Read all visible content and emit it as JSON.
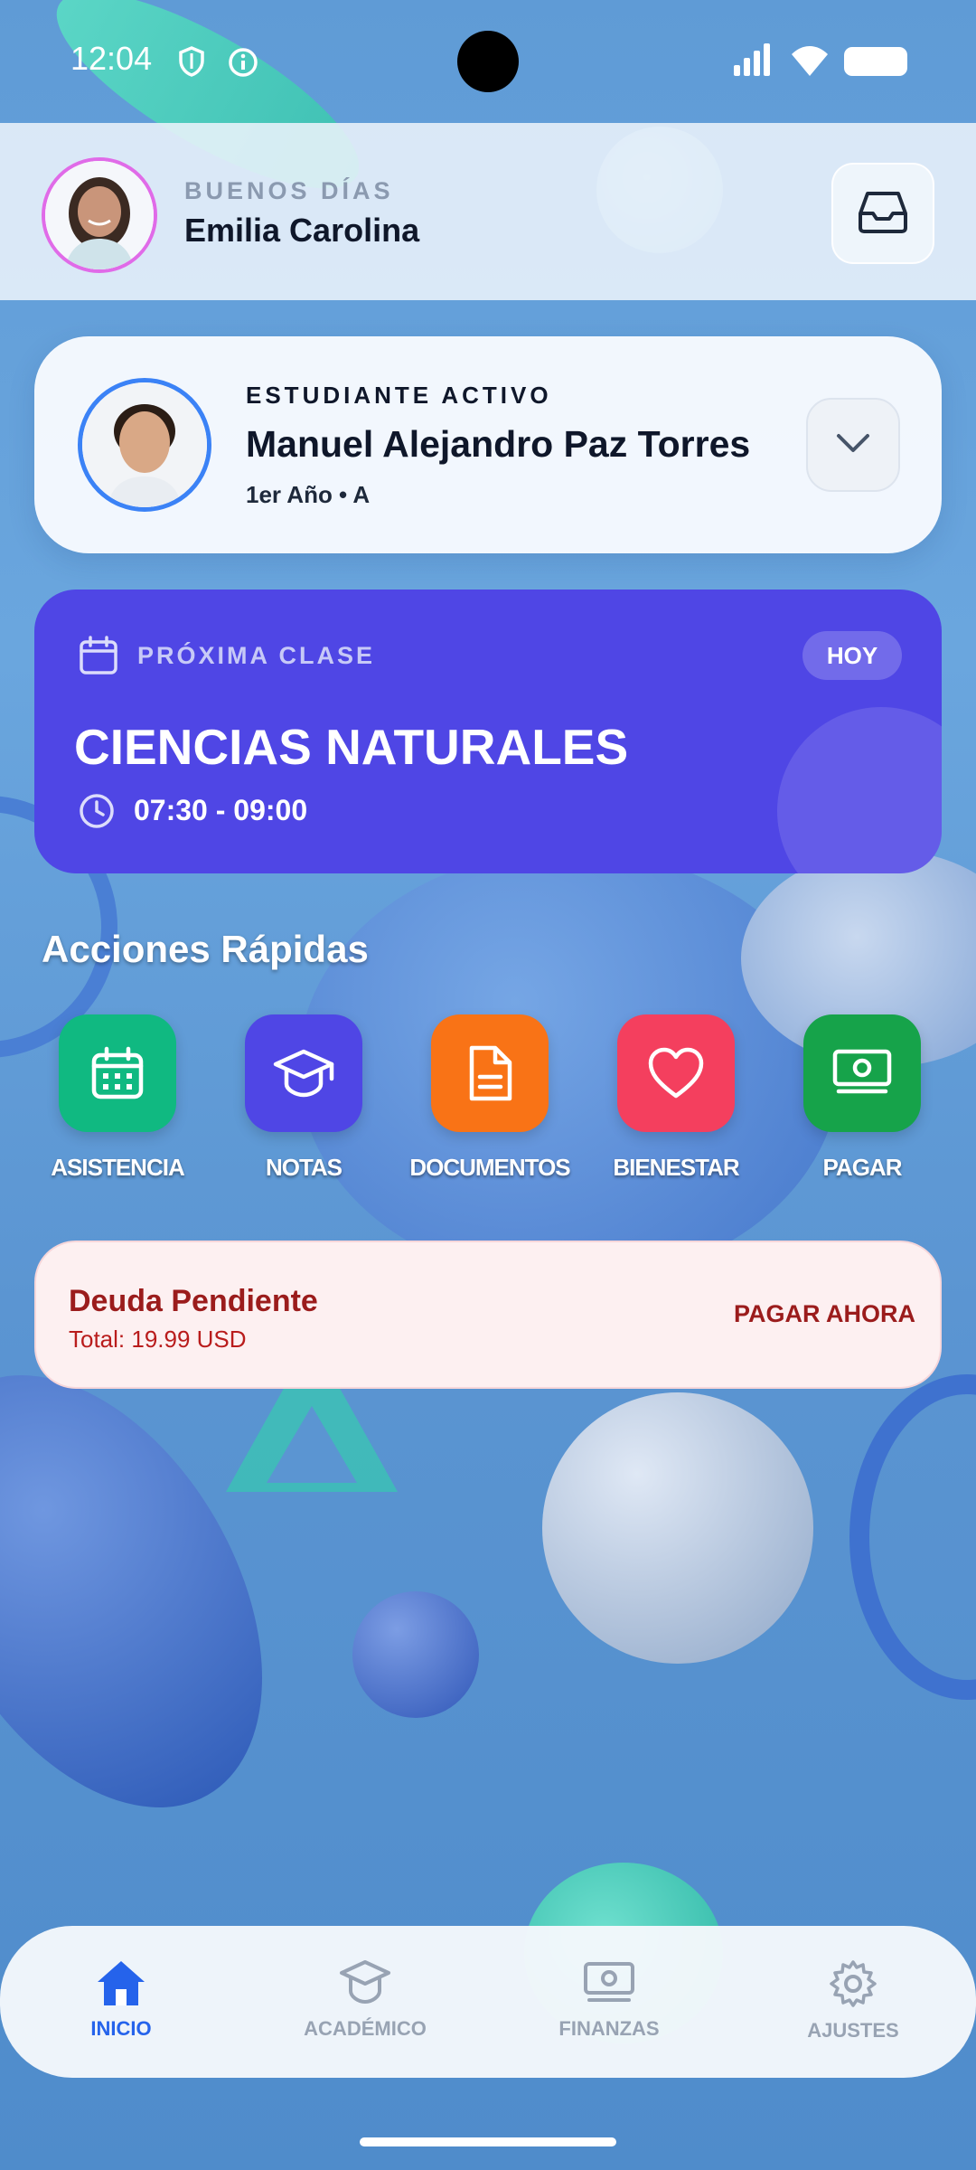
{
  "status_bar": {
    "time": "12:04"
  },
  "header": {
    "greeting": "BUENOS DÍAS",
    "user_name": "Emilia Carolina"
  },
  "student": {
    "tag": "ESTUDIANTE ACTIVO",
    "name": "Manuel Alejandro Paz Torres",
    "grade": "1er Año • A"
  },
  "next_class": {
    "label": "PRÓXIMA CLASE",
    "badge": "HOY",
    "subject": "CIENCIAS NATURALES",
    "time": "07:30 - 09:00",
    "color": "#4f46e5"
  },
  "quick_actions": {
    "title": "Acciones Rápidas",
    "items": [
      {
        "label": "ASISTENCIA",
        "icon": "calendar-icon",
        "color": "#10b981"
      },
      {
        "label": "NOTAS",
        "icon": "graduation-cap-icon",
        "color": "#4f46e5"
      },
      {
        "label": "DOCUMENTOS",
        "icon": "document-icon",
        "color": "#f97316"
      },
      {
        "label": "BIENESTAR",
        "icon": "heart-icon",
        "color": "#f43f5e"
      },
      {
        "label": "PAGAR",
        "icon": "money-icon",
        "color": "#16a34a"
      }
    ]
  },
  "debt": {
    "title": "Deuda Pendiente",
    "total": "Total: 19.99 USD",
    "action": "PAGAR AHORA"
  },
  "bottom_nav": {
    "items": [
      {
        "label": "INICIO",
        "icon": "home-icon",
        "active": true
      },
      {
        "label": "ACADÉMICO",
        "icon": "graduation-cap-icon",
        "active": false
      },
      {
        "label": "FINANZAS",
        "icon": "money-icon",
        "active": false
      },
      {
        "label": "AJUSTES",
        "icon": "gear-icon",
        "active": false
      }
    ],
    "active_color": "#2563eb"
  }
}
